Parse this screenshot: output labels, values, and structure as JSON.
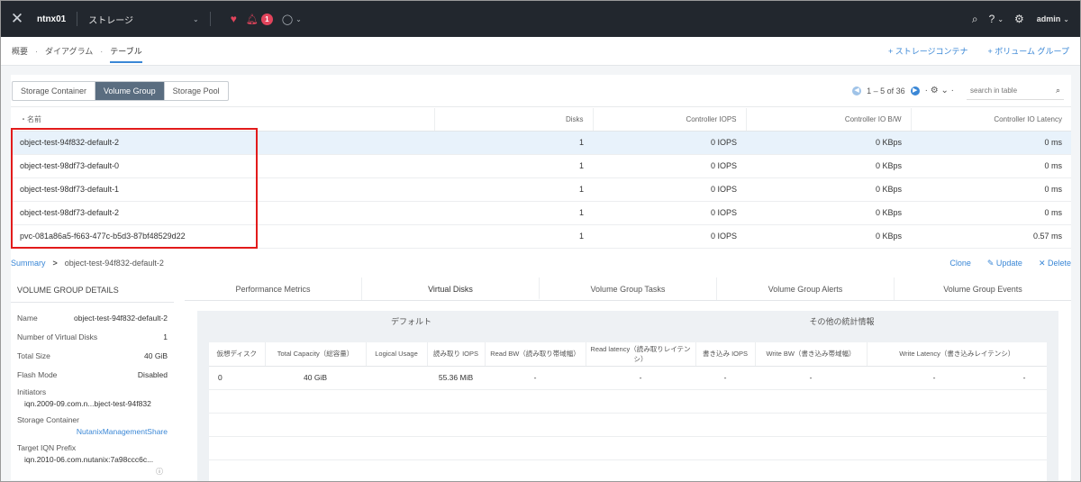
{
  "topbar": {
    "logo_icon": "nutanix-x-logo",
    "cluster_name": "ntnx01",
    "section": "ストレージ",
    "alert_count": "1",
    "user": "admin"
  },
  "subnav": {
    "crumbs": [
      "概要",
      "ダイアグラム",
      "テーブル"
    ],
    "active_crumb": "テーブル",
    "actions": [
      "+ ストレージコンテナ",
      "+ ボリューム グループ"
    ]
  },
  "tabs": [
    "Storage Container",
    "Volume Group",
    "Storage Pool"
  ],
  "active_tab": "Volume Group",
  "pager": {
    "range": "1 – 5 of 36",
    "search_placeholder": "search in table"
  },
  "vg_table": {
    "columns": [
      "・名前",
      "Disks",
      "Controller IOPS",
      "Controller IO B/W",
      "Controller IO Latency"
    ],
    "rows": [
      {
        "name": "object-test-94f832-default-2",
        "disks": "1",
        "iops": "0 IOPS",
        "bw": "0 KBps",
        "latency": "0 ms"
      },
      {
        "name": "object-test-98df73-default-0",
        "disks": "1",
        "iops": "0 IOPS",
        "bw": "0 KBps",
        "latency": "0 ms"
      },
      {
        "name": "object-test-98df73-default-1",
        "disks": "1",
        "iops": "0 IOPS",
        "bw": "0 KBps",
        "latency": "0 ms"
      },
      {
        "name": "object-test-98df73-default-2",
        "disks": "1",
        "iops": "0 IOPS",
        "bw": "0 KBps",
        "latency": "0 ms"
      },
      {
        "name": "pvc-081a86a5-f663-477c-b5d3-87bf48529d22",
        "disks": "1",
        "iops": "0 IOPS",
        "bw": "0 KBps",
        "latency": "0.57 ms"
      }
    ]
  },
  "summary_bar": {
    "summary": "Summary",
    "chevron": ">",
    "object": "object-test-94f832-default-2",
    "actions": [
      "Clone",
      "✎ Update",
      "✕ Delete"
    ]
  },
  "details": {
    "header": "VOLUME GROUP DETAILS",
    "name_label": "Name",
    "name_value": "object-test-94f832-default-2",
    "vdisks_label": "Number of Virtual Disks",
    "vdisks_value": "1",
    "size_label": "Total Size",
    "size_value": "40 GiB",
    "flash_label": "Flash Mode",
    "flash_value": "Disabled",
    "initiators_label": "Initiators",
    "initiators_value": "iqn.2009-09.com.n...bject-test-94f832",
    "container_label": "Storage Container",
    "container_value": "NutanixManagementShare",
    "iqn_label": "Target IQN Prefix",
    "iqn_value": "iqn.2010-06.com.nutanix:7a98ccc6c..."
  },
  "detail_tabs": [
    "Performance Metrics",
    "Virtual Disks",
    "Volume Group Tasks",
    "Volume Group Alerts",
    "Volume Group Events"
  ],
  "active_detail_tab": "Virtual Disks",
  "vdisk_groups": [
    "デフォルト",
    "その他の統計情報"
  ],
  "vdisk_table": {
    "columns": [
      "仮想ディスク",
      "Total Capacity（総容量）",
      "Logical Usage",
      "読み取り IOPS",
      "Read BW（読み取り帯域幅）",
      "Read latency（読み取りレイテンシ）",
      "書き込み IOPS",
      "Write BW（書き込み帯域幅）",
      "Write Latency（書き込みレイテンシ）"
    ],
    "row": [
      "0",
      "40 GiB",
      "",
      "55.36 MiB",
      "-",
      "-",
      "-",
      "-",
      "-",
      "-"
    ]
  }
}
